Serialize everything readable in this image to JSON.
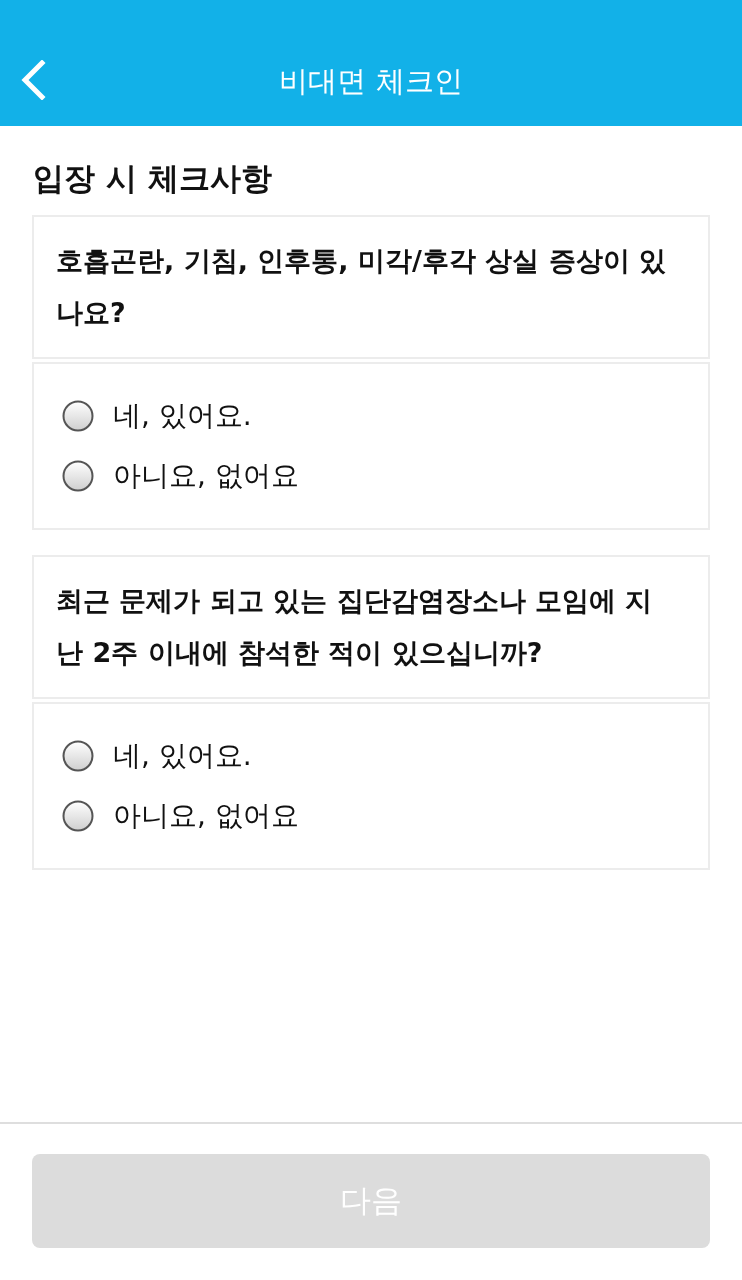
{
  "header": {
    "title": "비대면 체크인"
  },
  "section_title": "입장 시 체크사항",
  "questions": [
    {
      "text": "호흡곤란, 기침, 인후통, 미각/후각 상실 증상이 있나요?",
      "options": [
        {
          "label": "네, 있어요.",
          "selected": false
        },
        {
          "label": "아니요, 없어요",
          "selected": false
        }
      ]
    },
    {
      "text": "최근 문제가 되고 있는 집단감염장소나 모임에 지난 2주 이내에 참석한 적이 있으십니까?",
      "options": [
        {
          "label": "네, 있어요.",
          "selected": false
        },
        {
          "label": "아니요, 없어요",
          "selected": false
        }
      ]
    }
  ],
  "next_button": {
    "label": "다음",
    "disabled": true
  }
}
